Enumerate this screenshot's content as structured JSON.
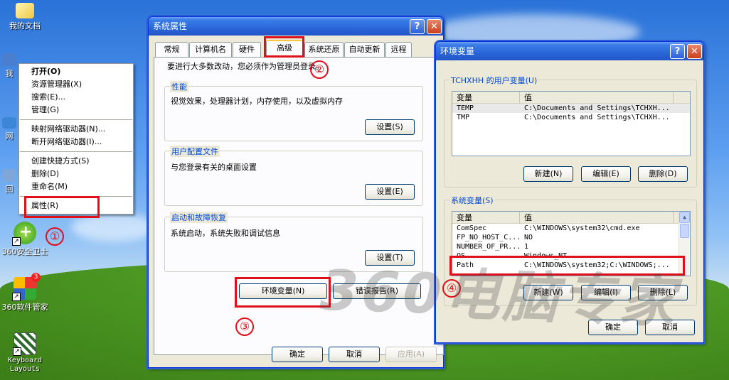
{
  "desktop": {
    "icons": [
      {
        "label": "我的文档",
        "icon": "folder-icon"
      },
      {
        "label": "我",
        "icon": "computer-icon"
      },
      {
        "label": "网",
        "icon": "network-icon"
      },
      {
        "label": "回",
        "icon": "recycle-icon"
      },
      {
        "label": "360安全卫士",
        "icon": "shield-icon"
      },
      {
        "label": "360软件管家",
        "icon": "software-manager-icon"
      },
      {
        "label": "Keyboard Layouts",
        "icon": "keyboard-icon"
      }
    ],
    "badge": "3",
    "watermark": "360电脑专家"
  },
  "context_menu": {
    "items": [
      {
        "label": "打开(O)",
        "bold": true
      },
      {
        "label": "资源管理器(X)"
      },
      {
        "label": "搜索(E)..."
      },
      {
        "label": "管理(G)"
      },
      {
        "label": "映射网络驱动器(N)..."
      },
      {
        "label": "断开网络驱动器(I)..."
      },
      {
        "label": "创建快捷方式(S)"
      },
      {
        "label": "删除(D)"
      },
      {
        "label": "重命名(M)"
      },
      {
        "label": "属性(R)"
      }
    ]
  },
  "sysprops": {
    "title": "系统属性",
    "tabs": [
      "常规",
      "计算机名",
      "硬件",
      "高级",
      "系统还原",
      "自动更新",
      "远程"
    ],
    "intro": "要进行大多数改动，您必须作为管理员登录。",
    "performance": {
      "title": "性能",
      "desc": "视觉效果，处理器计划，内存使用，以及虚拟内存",
      "button": "设置(S)"
    },
    "profiles": {
      "title": "用户配置文件",
      "desc": "与您登录有关的桌面设置",
      "button": "设置(E)"
    },
    "startup": {
      "title": "启动和故障恢复",
      "desc": "系统启动，系统失败和调试信息",
      "button": "设置(T)"
    },
    "env_button": "环境变量(N)",
    "error_button": "错误报告(R)",
    "ok": "确定",
    "cancel": "取消",
    "apply": "应用(A)"
  },
  "envvars": {
    "title": "环境变量",
    "user_group": "TCHXHH 的用户变量(U)",
    "headers": [
      "变量",
      "值"
    ],
    "user_rows": [
      {
        "name": "TEMP",
        "value": "C:\\Documents and Settings\\TCHXH..."
      },
      {
        "name": "TMP",
        "value": "C:\\Documents and Settings\\TCHXH..."
      }
    ],
    "user_buttons": [
      "新建(N)",
      "编辑(E)",
      "删除(D)"
    ],
    "sys_group": "系统变量(S)",
    "sys_rows": [
      {
        "name": "ComSpec",
        "value": "C:\\WINDOWS\\system32\\cmd.exe"
      },
      {
        "name": "FP_NO_HOST_C...",
        "value": "NO"
      },
      {
        "name": "NUMBER_OF_PR...",
        "value": "1"
      },
      {
        "name": "OS",
        "value": "Windows_NT"
      },
      {
        "name": "Path",
        "value": "C:\\WINDOWS\\system32;C:\\WINDOWS;..."
      }
    ],
    "sys_buttons": [
      "新建(W)",
      "编辑(I)",
      "删除(L)"
    ],
    "ok": "确定",
    "cancel": "取消"
  },
  "annotations": [
    "①",
    "②",
    "③",
    "④"
  ],
  "colors": {
    "annotation_red": "#e0101a",
    "xp_blue": "#2a66d8",
    "dialog_bg": "#ece9d8"
  }
}
